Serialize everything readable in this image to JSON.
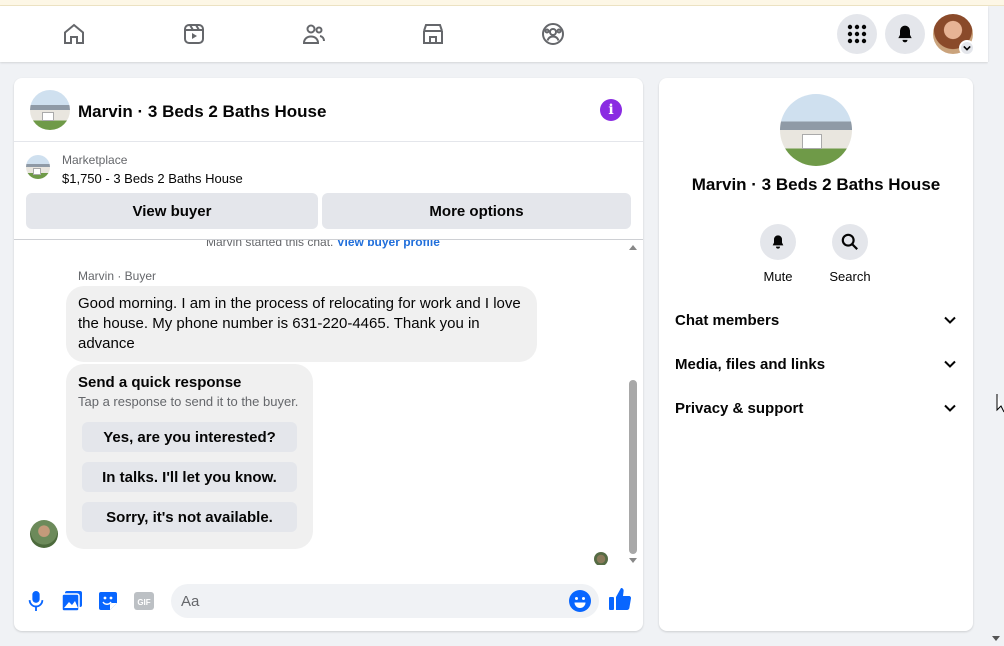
{
  "colors": {
    "accent": "#0866ff",
    "info": "#8a2be2",
    "link": "#216fdb",
    "bubble": "#f0f0f0",
    "button": "#e4e6eb"
  },
  "topnav": {
    "icons": [
      "home-icon",
      "video-icon",
      "friends-icon",
      "marketplace-icon",
      "groups-icon"
    ],
    "right_icons": [
      "menu-grid-icon",
      "notifications-icon",
      "account-avatar"
    ]
  },
  "chat": {
    "title": "Marvin · 3 Beds 2 Baths House",
    "marketplace_label": "Marketplace",
    "listing": "$1,750 - 3 Beds 2 Baths House",
    "view_buyer": "View buyer",
    "more_options": "More options",
    "started_text": "Marvin started this chat.",
    "view_buyer_profile": "View buyer profile",
    "sender": "Marvin · Buyer",
    "message": "Good morning. I am in the process of relocating for work and I love the house. My phone number is 631-220-4465. Thank you in advance",
    "quick_response": {
      "title": "Send a quick response",
      "subtitle": "Tap a response to send it to the buyer.",
      "options": [
        "Yes, are you interested?",
        "In talks. I'll let you know.",
        "Sorry, it's not available."
      ]
    },
    "composer_placeholder": "Aa"
  },
  "info_panel": {
    "title": "Marvin · 3 Beds 2 Baths House",
    "mute": "Mute",
    "search": "Search",
    "sections": [
      "Chat members",
      "Media, files and links",
      "Privacy & support"
    ]
  }
}
